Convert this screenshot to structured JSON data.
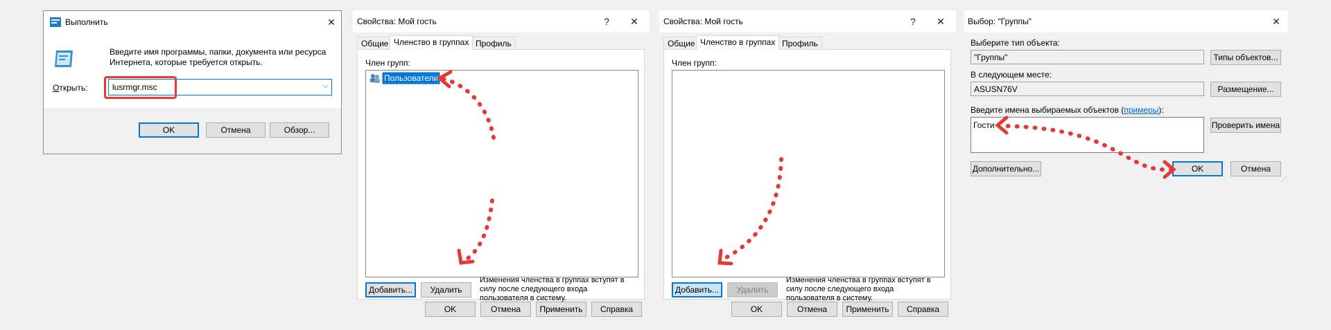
{
  "run_dialog": {
    "title": "Выполнить",
    "description": "Введите имя программы, папки, документа или ресурса Интернета, которые требуется открыть.",
    "open_label": "Открыть:",
    "open_value": "lusrmgr.msc",
    "ok": "OK",
    "cancel": "Отмена",
    "browse": "Обзор..."
  },
  "props_dialog_1": {
    "title": "Свойства: Мой гость",
    "help": "?",
    "tabs": [
      "Общие",
      "Членство в группах",
      "Профиль"
    ],
    "member_of_label": "Член групп:",
    "members": [
      "Пользователи"
    ],
    "add": "Добавить...",
    "remove": "Удалить",
    "note": "Изменения членства в группах вступят в силу после следующего входа пользователя в систему.",
    "ok": "OK",
    "cancel": "Отмена",
    "apply": "Применить",
    "help_btn": "Справка"
  },
  "props_dialog_2": {
    "title": "Свойства: Мой гость",
    "help": "?",
    "tabs": [
      "Общие",
      "Членство в группах",
      "Профиль"
    ],
    "member_of_label": "Член групп:",
    "add": "Добавить...",
    "remove": "Удалить",
    "note": "Изменения членства в группах вступят в силу после следующего входа пользователя в систему.",
    "ok": "OK",
    "cancel": "Отмена",
    "apply": "Применить",
    "help_btn": "Справка"
  },
  "select_dialog": {
    "title": "Выбор: \"Группы\"",
    "object_type_label": "Выберите тип объекта:",
    "object_type_value": "\"Группы\"",
    "object_types_btn": "Типы объектов...",
    "location_label": "В следующем месте:",
    "location_value": "ASUSN76V",
    "location_btn": "Размещение...",
    "names_label_pre": "Введите имена выбираемых объектов (",
    "names_label_link": "примеры",
    "names_label_post": "):",
    "names_value": "Гости",
    "check_names_btn": "Проверить имена",
    "advanced_btn": "Дополнительно...",
    "ok": "OK",
    "cancel": "Отмена"
  },
  "colors": {
    "annotation_red": "#e53935",
    "accent_blue": "#0078d7",
    "selection_blue": "#0078d7"
  }
}
